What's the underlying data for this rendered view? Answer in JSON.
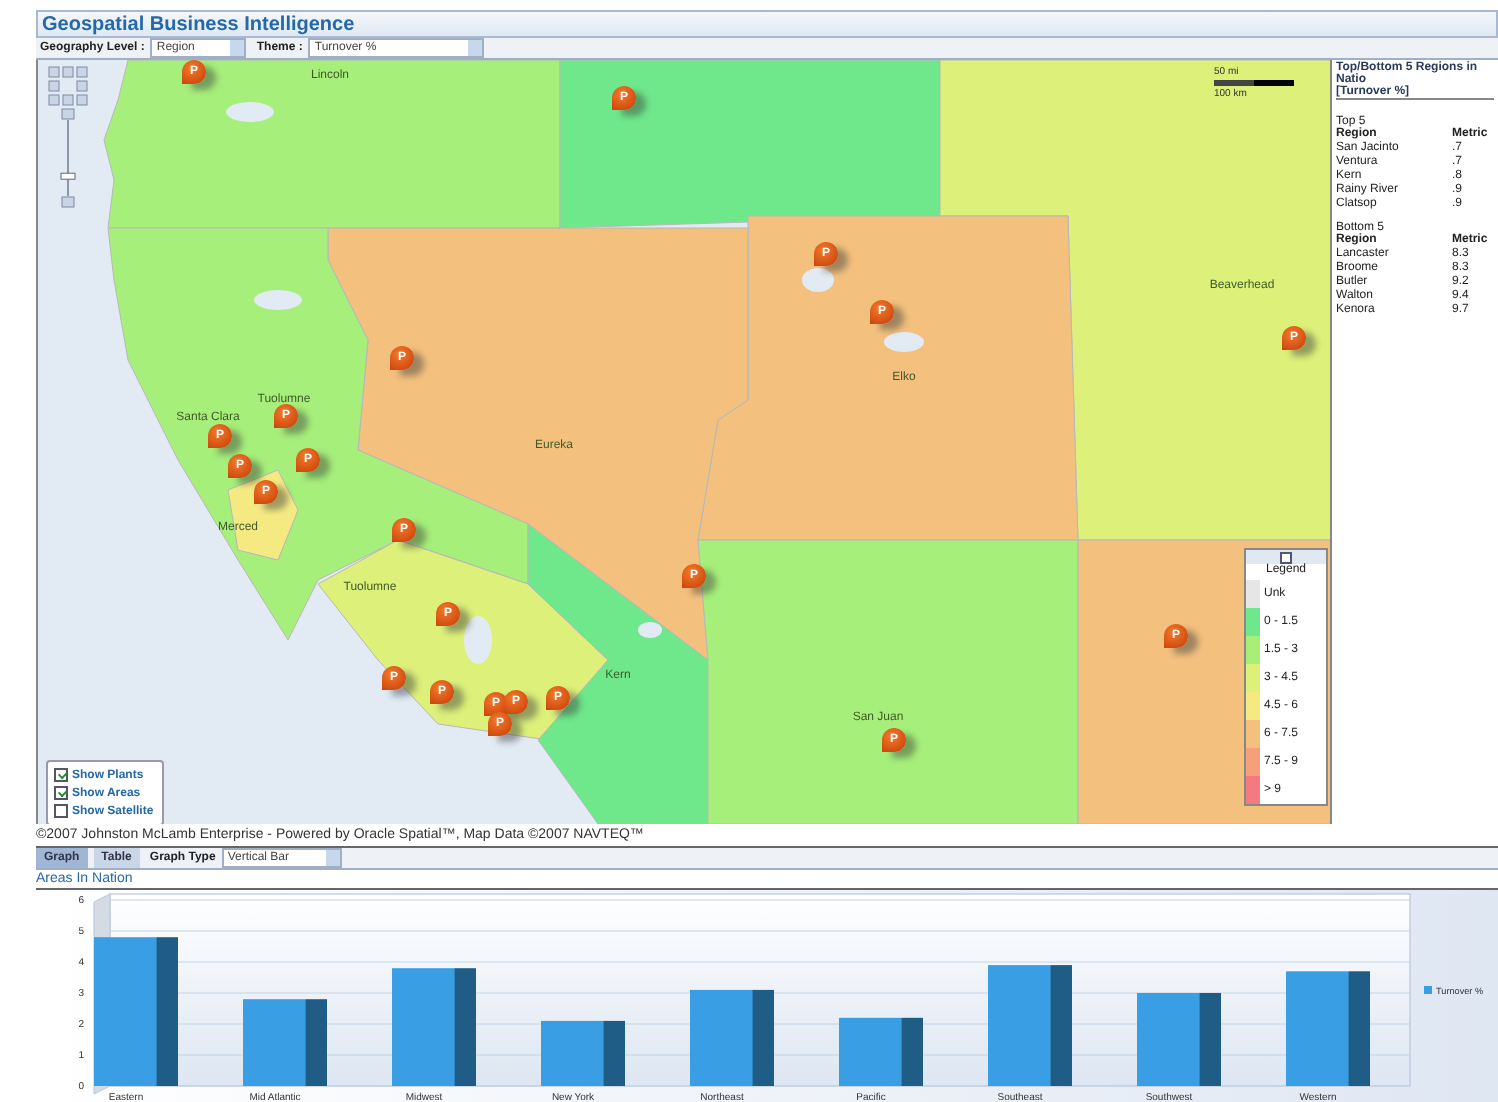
{
  "app": {
    "title": "Geospatial Business Intelligence"
  },
  "toolbar": {
    "geography_label": "Geography Level :",
    "geography_value": "Region",
    "theme_label": "Theme :",
    "theme_value": "Turnover %"
  },
  "map": {
    "region_labels": [
      {
        "name": "Lincoln"
      },
      {
        "name": "Tuolumne"
      },
      {
        "name": "Santa Clara"
      },
      {
        "name": "Merced"
      },
      {
        "name": "Eureka"
      },
      {
        "name": "Elko"
      },
      {
        "name": "Beaverhead"
      },
      {
        "name": "Tuolumne"
      },
      {
        "name": "Kern"
      },
      {
        "name": "San Juan"
      }
    ],
    "plants": [
      {
        "label": "P"
      },
      {
        "label": "P"
      },
      {
        "label": "P"
      },
      {
        "label": "P"
      },
      {
        "label": "P"
      },
      {
        "label": "P"
      },
      {
        "label": "P"
      },
      {
        "label": "P"
      },
      {
        "label": "P"
      },
      {
        "label": "P"
      },
      {
        "label": "P"
      },
      {
        "label": "P"
      },
      {
        "label": "P"
      },
      {
        "label": "P"
      },
      {
        "label": "P"
      },
      {
        "label": "P"
      },
      {
        "label": "P"
      },
      {
        "label": "P"
      },
      {
        "label": "P"
      },
      {
        "label": "P"
      },
      {
        "label": "P"
      },
      {
        "label": "P"
      }
    ],
    "scale": {
      "miles": "50 mi",
      "km": "100 km"
    },
    "zoom_slider": {
      "level": 0.3
    },
    "layers": [
      {
        "label": "Show Plants",
        "checked": true
      },
      {
        "label": "Show Areas",
        "checked": true
      },
      {
        "label": "Show Satellite",
        "checked": false
      }
    ],
    "legend": {
      "title": "Legend",
      "items": [
        {
          "label": "Unk",
          "color": "#e6e6e6"
        },
        {
          "label": "0 - 1.5",
          "color": "#6ee88a"
        },
        {
          "label": "1.5 - 3",
          "color": "#a8ef78"
        },
        {
          "label": "3 - 4.5",
          "color": "#dcf07a"
        },
        {
          "label": "4.5 - 6",
          "color": "#f5ea82"
        },
        {
          "label": "6 - 7.5",
          "color": "#f3c07e"
        },
        {
          "label": "7.5 - 9",
          "color": "#f5a07a"
        },
        {
          "label": "> 9",
          "color": "#f47a80"
        }
      ]
    },
    "copyright": "©2007 Johnston McLamb Enterprise - Powered by Oracle Spatial™, Map Data ©2007 NAVTEQ™"
  },
  "side_panel": {
    "title": "Top/Bottom 5 Regions in Natio",
    "subtitle": "[Turnover %]",
    "top": {
      "heading": "Top 5",
      "columns": [
        "Region",
        "Metric"
      ],
      "rows": [
        [
          "San Jacinto",
          ".7"
        ],
        [
          "Ventura",
          ".7"
        ],
        [
          "Kern",
          ".8"
        ],
        [
          "Rainy River",
          ".9"
        ],
        [
          "Clatsop",
          ".9"
        ]
      ]
    },
    "bottom": {
      "heading": "Bottom 5",
      "columns": [
        "Region",
        "Metric"
      ],
      "rows": [
        [
          "Lancaster",
          "8.3"
        ],
        [
          "Broome",
          "8.3"
        ],
        [
          "Butler",
          "9.2"
        ],
        [
          "Walton",
          "9.4"
        ],
        [
          "Kenora",
          "9.7"
        ]
      ]
    }
  },
  "tabs": [
    {
      "label": "Graph",
      "selected": true
    },
    {
      "label": "Table",
      "selected": false
    }
  ],
  "graph_type": {
    "label": "Graph Type",
    "value": "Vertical Bar"
  },
  "chart_section": {
    "title": "Areas In Nation",
    "chart_data": {
      "type": "bar",
      "categories": [
        "Eastern",
        "Mid Atlantic",
        "Midwest",
        "New York",
        "Northeast",
        "Pacific",
        "Southeast",
        "Southwest",
        "Western"
      ],
      "series": [
        {
          "name": "Turnover %",
          "color": "#3a9ee4",
          "values": [
            4.8,
            2.8,
            3.8,
            2.1,
            3.1,
            2.2,
            3.9,
            3.0,
            3.7
          ]
        }
      ],
      "ylim": [
        0,
        6
      ],
      "yticks": [
        0,
        1,
        2,
        3,
        4,
        5,
        6
      ],
      "grid": true
    }
  }
}
